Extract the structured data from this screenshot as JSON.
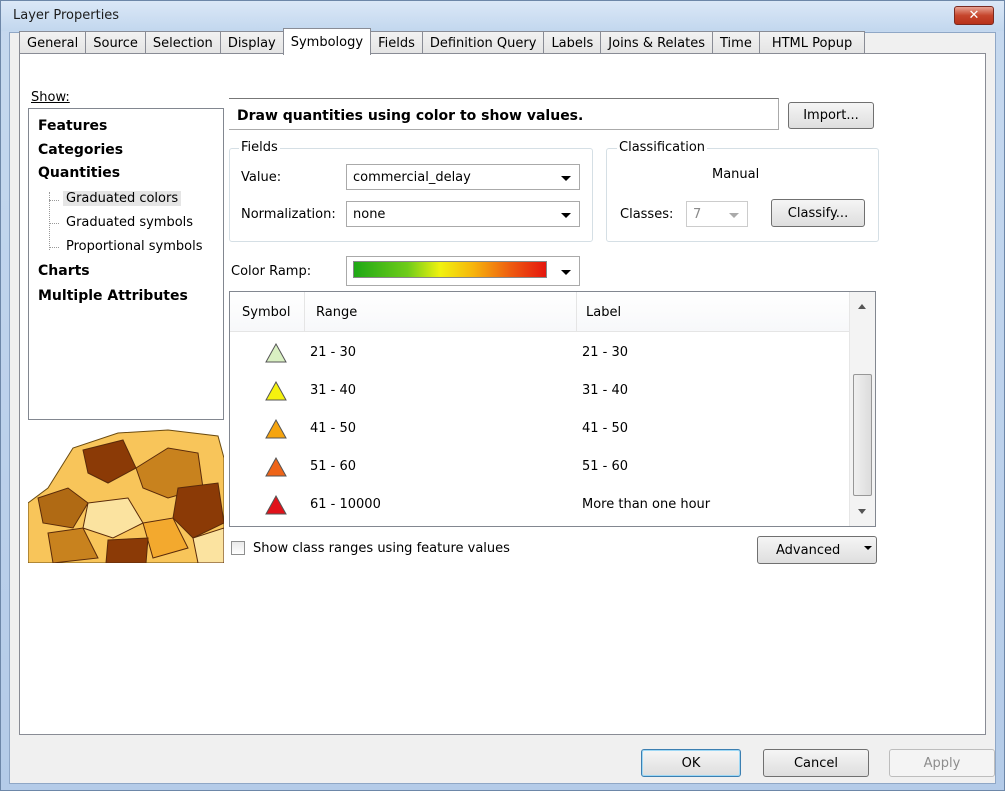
{
  "window": {
    "title": "Layer Properties",
    "close_glyph": "✕"
  },
  "tabs": [
    {
      "label": "General"
    },
    {
      "label": "Source"
    },
    {
      "label": "Selection"
    },
    {
      "label": "Display"
    },
    {
      "label": "Symbology",
      "active": true
    },
    {
      "label": "Fields"
    },
    {
      "label": "Definition Query"
    },
    {
      "label": "Labels"
    },
    {
      "label": "Joins & Relates"
    },
    {
      "label": "Time"
    },
    {
      "label": "HTML Popup"
    }
  ],
  "show": {
    "label": "Show:",
    "items": [
      "Features",
      "Categories",
      "Quantities",
      "Charts",
      "Multiple Attributes"
    ],
    "sub_items": [
      "Graduated colors",
      "Graduated symbols",
      "Proportional symbols"
    ],
    "selected_sub": "Graduated colors"
  },
  "description": "Draw quantities using color to show values.",
  "import_button": "Import...",
  "fields_group": {
    "title": "Fields",
    "value_label": "Value:",
    "value": "commercial_delay",
    "normalization_label": "Normalization:",
    "normalization": "none"
  },
  "classification_group": {
    "title": "Classification",
    "method": "Manual",
    "classes_label": "Classes:",
    "classes_value": "7",
    "classify_button": "Classify..."
  },
  "color_ramp_label": "Color Ramp:",
  "table": {
    "headers": {
      "symbol": "Symbol",
      "range": "Range",
      "label": "Label"
    },
    "rows": [
      {
        "range": "21 - 30",
        "label": "21 - 30",
        "color": "#d9f0c2"
      },
      {
        "range": "31 - 40",
        "label": "31 - 40",
        "color": "#f5f20f"
      },
      {
        "range": "41 - 50",
        "label": "41 - 50",
        "color": "#f5a40f"
      },
      {
        "range": "51 - 60",
        "label": "51 - 60",
        "color": "#ee6418"
      },
      {
        "range": "61 - 10000",
        "label": "More than one hour",
        "color": "#e0121a"
      }
    ]
  },
  "show_class_ranges": "Show class ranges using feature values",
  "advanced_button": "Advanced",
  "buttons": {
    "ok": "OK",
    "cancel": "Cancel",
    "apply": "Apply"
  }
}
